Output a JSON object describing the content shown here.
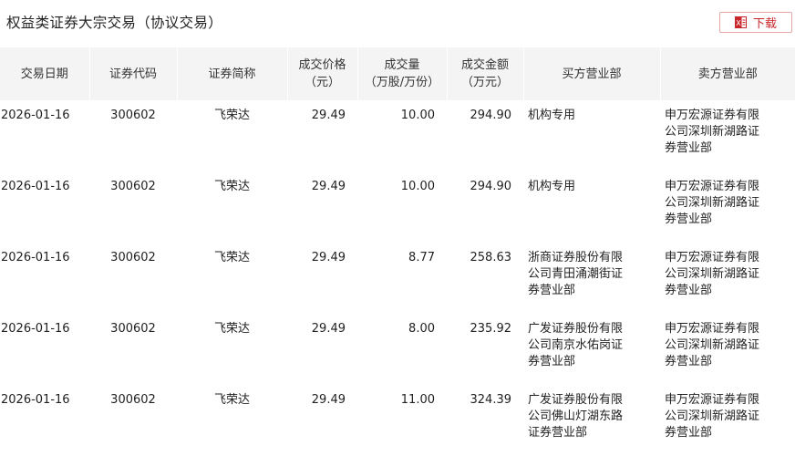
{
  "header": {
    "title": "权益类证券大宗交易（协议交易）",
    "download_label": "下载"
  },
  "colors": {
    "accent": "#c9262c",
    "header_bg": "#f4f4f4"
  },
  "table": {
    "columns": [
      {
        "line1": "交易日期",
        "line2": ""
      },
      {
        "line1": "证券代码",
        "line2": ""
      },
      {
        "line1": "证券简称",
        "line2": ""
      },
      {
        "line1": "成交价格",
        "line2": "（元）"
      },
      {
        "line1": "成交量",
        "line2": "（万股/万份）"
      },
      {
        "line1": "成交金额",
        "line2": "（万元）"
      },
      {
        "line1": "买方营业部",
        "line2": ""
      },
      {
        "line1": "卖方营业部",
        "line2": ""
      }
    ],
    "rows": [
      {
        "date": "2026-01-16",
        "code": "300602",
        "name": "飞荣达",
        "price": "29.49",
        "volume": "10.00",
        "amount": "294.90",
        "buyer": "机构专用",
        "seller": "申万宏源证券有限公司深圳新湖路证券营业部"
      },
      {
        "date": "2026-01-16",
        "code": "300602",
        "name": "飞荣达",
        "price": "29.49",
        "volume": "10.00",
        "amount": "294.90",
        "buyer": "机构专用",
        "seller": "申万宏源证券有限公司深圳新湖路证券营业部"
      },
      {
        "date": "2026-01-16",
        "code": "300602",
        "name": "飞荣达",
        "price": "29.49",
        "volume": "8.77",
        "amount": "258.63",
        "buyer": "浙商证券股份有限公司青田涌潮街证券营业部",
        "seller": "申万宏源证券有限公司深圳新湖路证券营业部"
      },
      {
        "date": "2026-01-16",
        "code": "300602",
        "name": "飞荣达",
        "price": "29.49",
        "volume": "8.00",
        "amount": "235.92",
        "buyer": "广发证券股份有限公司南京水佑岗证券营业部",
        "seller": "申万宏源证券有限公司深圳新湖路证券营业部"
      },
      {
        "date": "2026-01-16",
        "code": "300602",
        "name": "飞荣达",
        "price": "29.49",
        "volume": "11.00",
        "amount": "324.39",
        "buyer": "广发证券股份有限公司佛山灯湖东路证券营业部",
        "seller": "申万宏源证券有限公司深圳新湖路证券营业部"
      }
    ]
  }
}
